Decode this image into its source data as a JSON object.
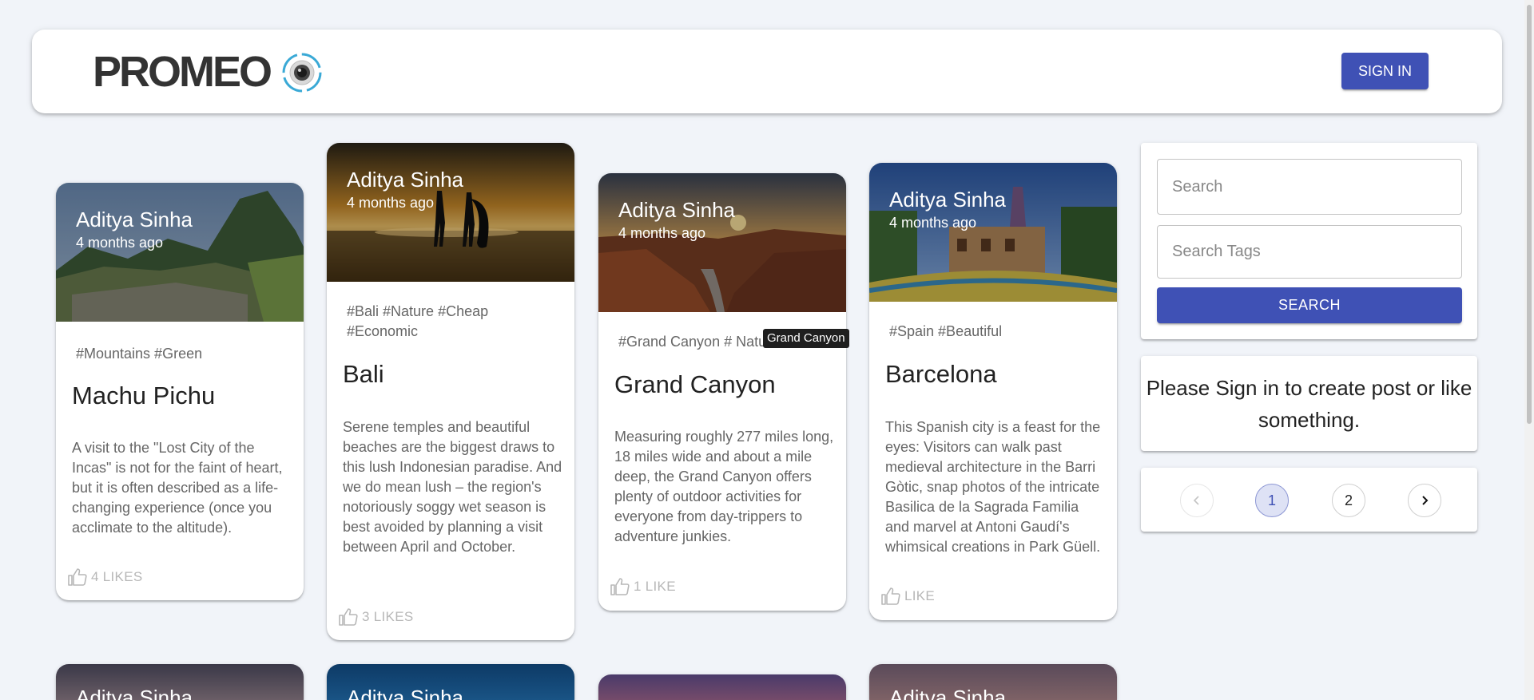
{
  "header": {
    "brand": "PROMEO",
    "sign_in_label": "SIGN IN"
  },
  "posts": [
    {
      "author": "Aditya Sinha",
      "time": "4 months ago",
      "tags": "#Mountains #Green",
      "title": "Machu Pichu",
      "body": "A visit to the \"Lost City of the Incas\" is not for the faint of heart, but it is often described as a life-changing experience (once you acclimate to the altitude).",
      "likes": "4 LIKES",
      "image_icon": "machu-picchu-photo"
    },
    {
      "author": "Aditya Sinha",
      "time": "4 months ago",
      "tags": "#Bali #Nature #Cheap #Economic",
      "title": "Bali",
      "body": "Serene temples and beautiful beaches are the biggest draws to this lush Indonesian paradise. And we do mean lush – the region's notoriously soggy wet season is best avoided by planning a visit between April and October.",
      "likes": "3 LIKES",
      "image_icon": "bali-beach-photo"
    },
    {
      "author": "Aditya Sinha",
      "time": "4 months ago",
      "tags": "#Grand Canyon # Natu",
      "title": "Grand Canyon",
      "body": "Measuring roughly 277 miles long, 18 miles wide and about a mile deep, the Grand Canyon offers plenty of outdoor activities for everyone from day-trippers to adventure junkies.",
      "likes": "1 LIKE",
      "tooltip": "Grand Canyon",
      "image_icon": "grand-canyon-photo"
    },
    {
      "author": "Aditya Sinha",
      "time": "4 months ago",
      "tags": "#Spain #Beautiful",
      "title": "Barcelona",
      "body": "This Spanish city is a feast for the eyes: Visitors can walk past medieval architecture in the Barri Gòtic, snap photos of the intricate Basilica de la Sagrada Familia and marvel at Antoni Gaudí's whimsical creations in Park Güell.",
      "likes": "LIKE",
      "image_icon": "barcelona-park-guell-photo"
    }
  ],
  "next_row": [
    {
      "author": "Aditya Sinha"
    },
    {
      "author": "Aditya Sinha"
    },
    {
      "author": ""
    },
    {
      "author": "Aditya Sinha"
    }
  ],
  "search": {
    "search_placeholder": "Search",
    "tags_placeholder": "Search Tags",
    "button_label": "SEARCH"
  },
  "notice": {
    "text": "Please Sign in to create post or like something."
  },
  "pagination": {
    "pages": [
      "1",
      "2"
    ],
    "current": "1"
  },
  "colors": {
    "primary": "#3f51b5",
    "background": "#f1f4f9"
  }
}
